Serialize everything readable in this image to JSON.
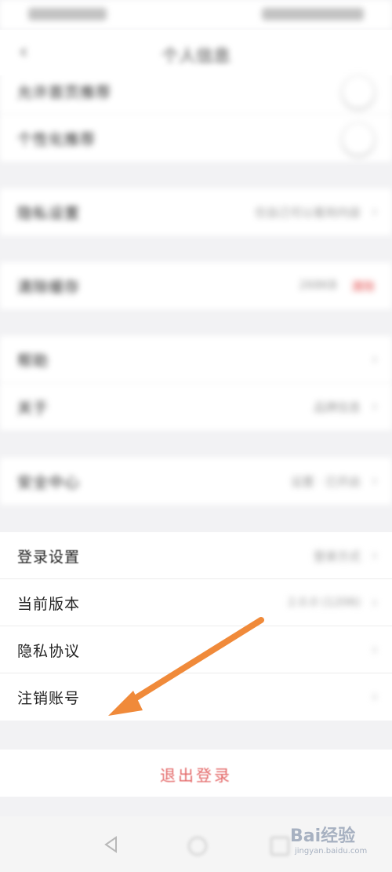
{
  "header": {
    "title": "个人信息"
  },
  "groups_top": [
    {
      "label": "允许首页推荐",
      "control": "toggle"
    },
    {
      "label": "个性化推荐",
      "control": "toggle"
    }
  ],
  "group_privacy": {
    "label": "隐私设置",
    "value": "仅自己可以看到内容"
  },
  "group_cache": {
    "label": "清除缓存",
    "value": "268KB",
    "action": "清除"
  },
  "group_account": [
    {
      "label": "帮助",
      "value": ""
    },
    {
      "label": "关于",
      "value": "品牌信息"
    }
  ],
  "group_security": {
    "label": "安全中心",
    "value": "设置 · 已开启"
  },
  "group_bottom": [
    {
      "label": "登录设置",
      "value": "登录方式"
    },
    {
      "label": "当前版本",
      "value": "2.0.0 (1206)"
    },
    {
      "label": "隐私协议",
      "value": ""
    },
    {
      "label": "注销账号",
      "value": ""
    }
  ],
  "logout": {
    "label": "退出登录"
  },
  "watermark": {
    "logo": "Bai经验",
    "url": "jingyan.baidu.com"
  },
  "colors": {
    "arrow": "#f08a3a",
    "logout": "#e46a6a",
    "background": "#f2f2f4"
  }
}
